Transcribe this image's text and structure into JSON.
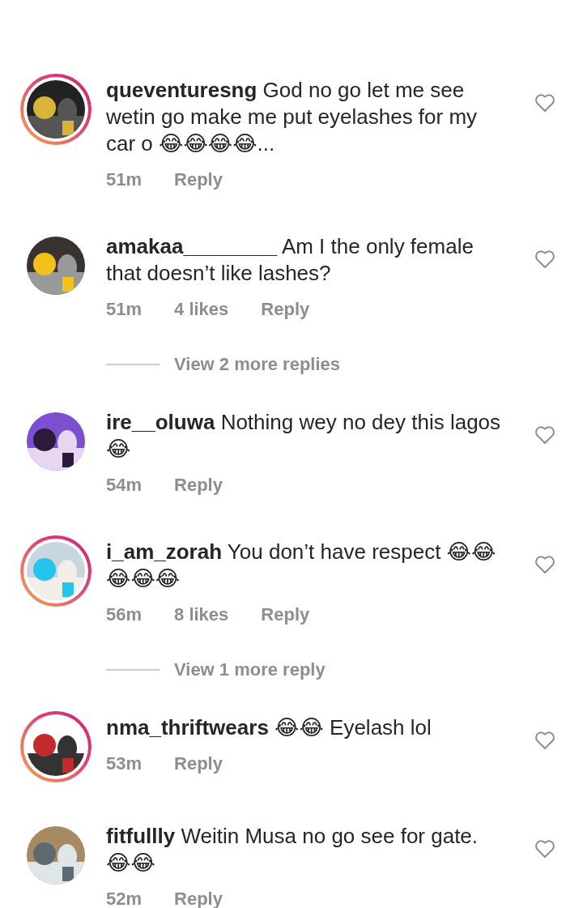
{
  "comments": [
    {
      "username": "queventuresng",
      "text": "God no go let me see wetin go make me put eyelashes for my car o 😂😂😂😂...",
      "time": "51m",
      "reply": "Reply",
      "story_ring": true,
      "liked": false
    },
    {
      "username": "amakaa________",
      "text": "Am I the only female that doesn’t like lashes?",
      "time": "51m",
      "likes": "4 likes",
      "reply": "Reply",
      "story_ring": false,
      "liked": false,
      "view_replies": "View 2 more replies"
    },
    {
      "username": "ire__oluwa",
      "text": "Nothing wey no dey this lagos😂",
      "time": "54m",
      "reply": "Reply",
      "story_ring": false,
      "liked": false
    },
    {
      "username": "i_am_zorah",
      "text": "You don’t have respect 😂😂😂😂😂",
      "time": "56m",
      "likes": "8 likes",
      "reply": "Reply",
      "story_ring": true,
      "liked": false,
      "view_replies": "View 1 more reply"
    },
    {
      "username": "nma_thriftwears",
      "text": "😂😂 Eyelash lol",
      "time": "53m",
      "reply": "Reply",
      "story_ring": true,
      "liked": false
    },
    {
      "username": "fitfullly",
      "text": "Weitin Musa no go see for gate. 😂😂",
      "time": "52m",
      "reply": "Reply",
      "story_ring": false,
      "liked": false
    }
  ]
}
